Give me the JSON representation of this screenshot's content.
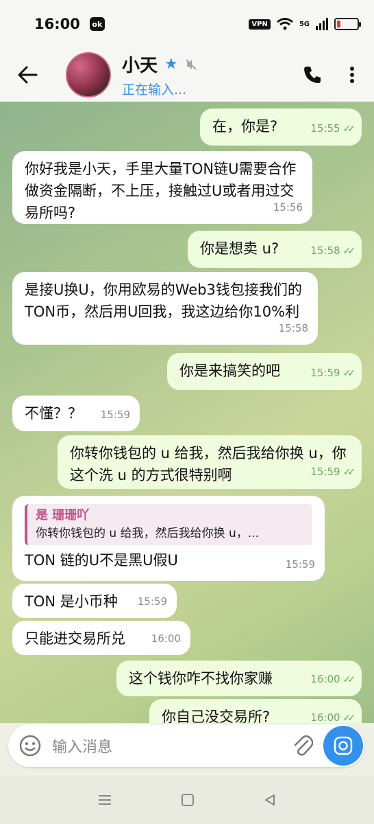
{
  "status": {
    "time": "16:00",
    "app_badge": "ok",
    "vpn": "VPN",
    "net": "5G"
  },
  "header": {
    "name": "小天",
    "typing": "正在输入..."
  },
  "messages": [
    {
      "dir": "out",
      "text": "在，你是?",
      "time": "15:55"
    },
    {
      "dir": "in",
      "text": "你好我是小天，手里大量TON链U需要合作做资金隔断，不上压，接触过U或者用过交易所吗?",
      "time": "15:56"
    },
    {
      "dir": "out",
      "text": "你是想卖 u?",
      "time": "15:58"
    },
    {
      "dir": "in",
      "text": "是接U换U，你用欧易的Web3钱包接我们的TON币，然后用U回我，我这边给你10%利",
      "time": "15:58"
    },
    {
      "dir": "out",
      "text": "你是来搞笑的吧",
      "time": "15:59"
    },
    {
      "dir": "in",
      "text": "不懂？？",
      "time": "15:59"
    },
    {
      "dir": "out",
      "text": "你转你钱包的 u 给我，然后我给你换 u，你这个洗 u 的方式很特别啊",
      "time": "15:59"
    },
    {
      "dir": "in",
      "reply_name": "是 珊珊吖",
      "reply_text": "你转你钱包的 u 给我，然后我给你换 u，...",
      "text": "TON 链的U不是黑U假U",
      "time": "15:59"
    },
    {
      "dir": "in",
      "text": "TON 是小币种",
      "time": "15:59"
    },
    {
      "dir": "in",
      "text": "只能进交易所兑",
      "time": "16:00"
    },
    {
      "dir": "out",
      "text": "这个钱你咋不找你家赚",
      "time": "16:00"
    },
    {
      "dir": "out",
      "text": "你自己没交易所?",
      "time": "16:00"
    }
  ],
  "input": {
    "placeholder": "输入消息"
  },
  "colors": {
    "accent": "#3390ec",
    "outgoing_bubble": "#effdde",
    "incoming_bubble": "#ffffff",
    "reply_accent": "#c0538a"
  },
  "icons": [
    "back-arrow-icon",
    "verified-star-icon",
    "muted-icon",
    "phone-icon",
    "more-vertical-icon",
    "emoji-icon",
    "attach-icon",
    "camera-icon"
  ]
}
